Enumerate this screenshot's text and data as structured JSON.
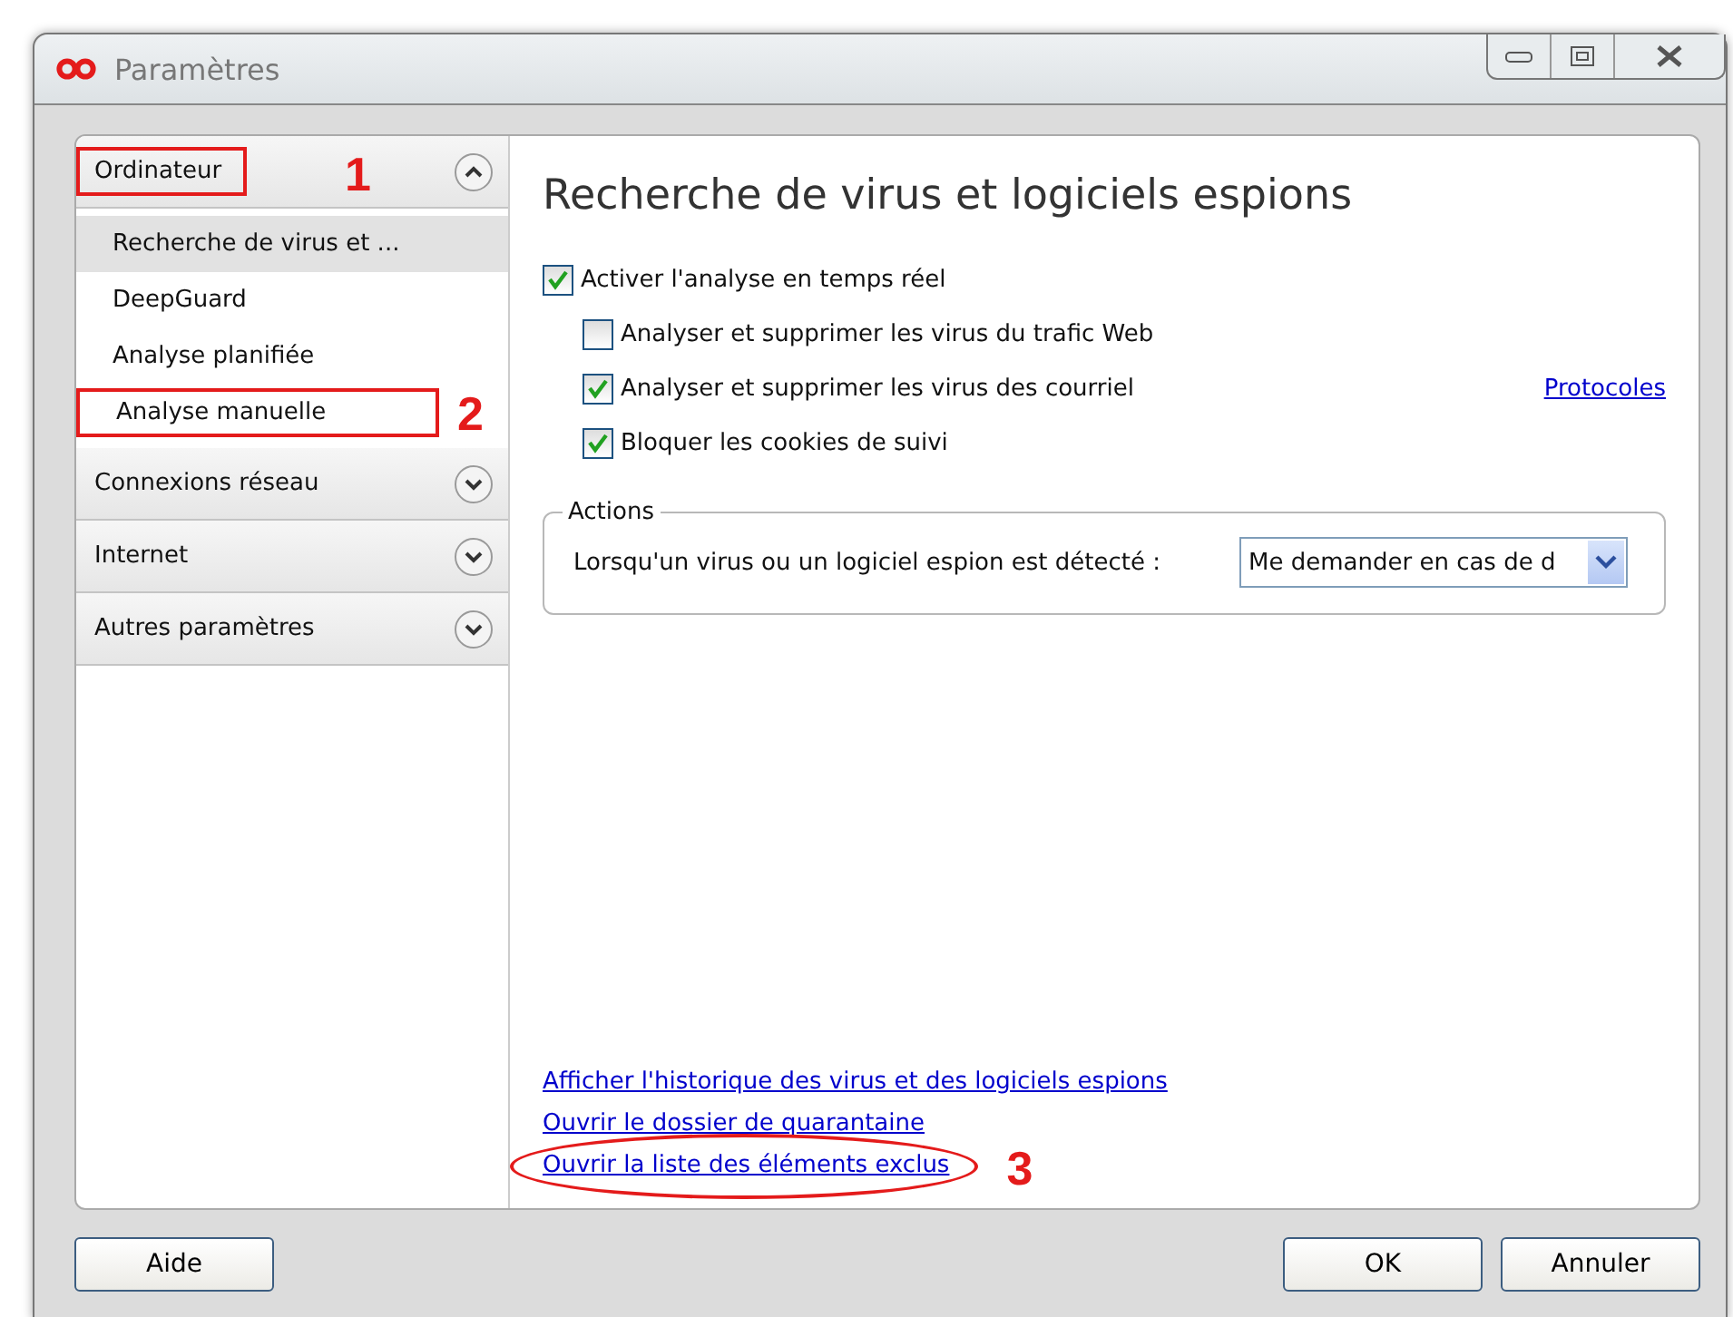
{
  "window": {
    "title": "Paramètres"
  },
  "sidebar": {
    "sections": [
      {
        "label": "Ordinateur",
        "expanded": true,
        "callout": "1",
        "items": [
          {
            "label": "Recherche de virus et ...",
            "selected": true
          },
          {
            "label": "DeepGuard",
            "selected": false
          },
          {
            "label": "Analyse planifiée",
            "selected": false
          },
          {
            "label": "Analyse manuelle",
            "selected": false,
            "callout": "2"
          }
        ]
      },
      {
        "label": "Connexions réseau",
        "expanded": false
      },
      {
        "label": "Internet",
        "expanded": false
      },
      {
        "label": "Autres paramètres",
        "expanded": false
      }
    ]
  },
  "main": {
    "title": "Recherche de virus et logiciels espions",
    "options": [
      {
        "label": "Activer l'analyse en temps réel",
        "checked": true,
        "nested": false
      },
      {
        "label": "Analyser et supprimer les virus du trafic Web",
        "checked": false,
        "nested": true
      },
      {
        "label": "Analyser et supprimer les virus des courriel",
        "checked": true,
        "nested": true,
        "link": "Protocoles"
      },
      {
        "label": "Bloquer les cookies de suivi",
        "checked": true,
        "nested": true
      }
    ],
    "actions": {
      "legend": "Actions",
      "label": "Lorsqu'un virus ou un logiciel espion est détecté :",
      "value": "Me demander en cas de d"
    },
    "links": [
      {
        "label": "Afficher l'historique des virus et des logiciels espions"
      },
      {
        "label": "Ouvrir le dossier de quarantaine"
      },
      {
        "label": "Ouvrir la liste des éléments exclus",
        "callout": "3"
      }
    ]
  },
  "buttons": {
    "left": [
      "Aide"
    ],
    "right": [
      "OK",
      "Annuler"
    ]
  }
}
